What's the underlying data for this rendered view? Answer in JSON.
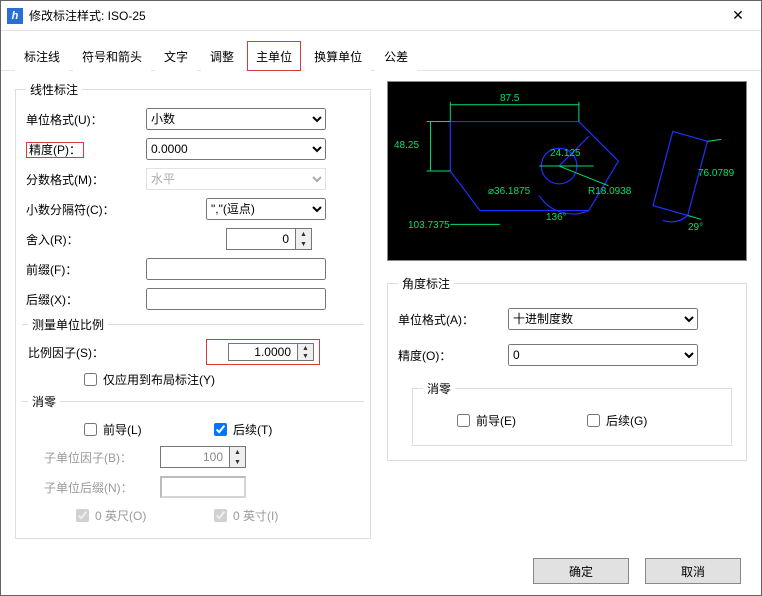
{
  "window": {
    "title": "修改标注样式: ISO-25"
  },
  "tabs": {
    "t0": "标注线",
    "t1": "符号和箭头",
    "t2": "文字",
    "t3": "调整",
    "t4": "主单位",
    "t5": "换算单位",
    "t6": "公差"
  },
  "linear": {
    "legend": "线性标注",
    "unit_format_label": "单位格式(U)：",
    "unit_format_value": "小数",
    "precision_label": "精度(P)：",
    "precision_value": "0.0000",
    "fraction_format_label": "分数格式(M)：",
    "fraction_format_value": "水平",
    "decimal_sep_label": "小数分隔符(C)：",
    "decimal_sep_value": "\",\"(逗点)",
    "round_label": "舍入(R)：",
    "round_value": "0",
    "prefix_label": "前缀(F)：",
    "prefix_value": "",
    "suffix_label": "后缀(X)：",
    "suffix_value": ""
  },
  "scale": {
    "legend": "测量单位比例",
    "factor_label": "比例因子(S)：",
    "factor_value": "1.0000",
    "apply_layout_only": "仅应用到布局标注(Y)"
  },
  "zerosL": {
    "legend": "消零",
    "leading": "前导(L)",
    "trailing": "后续(T)",
    "subunit_factor_label": "子单位因子(B)：",
    "subunit_factor_value": "100",
    "subunit_suffix_label": "子单位后缀(N)：",
    "subunit_suffix_value": "",
    "zero_feet": "0 英尺(O)",
    "zero_inch": "0 英寸(I)"
  },
  "angle": {
    "legend": "角度标注",
    "unit_format_label": "单位格式(A)：",
    "unit_format_value": "十进制度数",
    "precision_label": "精度(O)：",
    "precision_value": "0",
    "zeros_legend": "消零",
    "leading": "前导(E)",
    "trailing": "后续(G)"
  },
  "preview": {
    "d1": "87.5",
    "d2": "48.25",
    "d3": "24.125",
    "d4": "⌀36.1875",
    "d5": "R18.0938",
    "d6": "76.0789",
    "d7": "103.7375",
    "a1": "136°",
    "a2": "29°"
  },
  "buttons": {
    "ok": "确定",
    "cancel": "取消"
  }
}
